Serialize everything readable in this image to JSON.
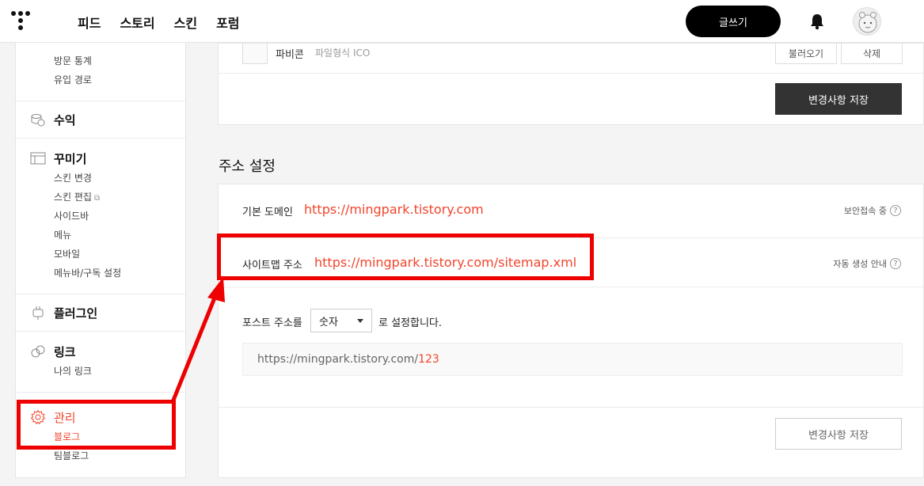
{
  "header": {
    "nav": [
      "피드",
      "스토리",
      "스킨",
      "포럼"
    ],
    "write_label": "글쓰기"
  },
  "sidebar": {
    "stats_subs": [
      "방문 통계",
      "유입 경로"
    ],
    "revenue": "수익",
    "decorate": {
      "title": "꾸미기",
      "items": [
        "스킨 변경",
        "스킨 편집",
        "사이드바",
        "메뉴",
        "모바일",
        "메뉴바/구독 설정"
      ]
    },
    "plugin": "플러그인",
    "link": {
      "title": "링크",
      "items": [
        "나의 링크"
      ]
    },
    "manage": {
      "title": "관리",
      "items": [
        "블로그",
        "팀블로그"
      ]
    }
  },
  "favicon": {
    "label": "파비콘",
    "note": "파일형식 ICO",
    "load_label": "불러오기",
    "delete_label": "삭제",
    "save_label": "변경사항 저장"
  },
  "address": {
    "title": "주소 설정",
    "domain_label": "기본 도메인",
    "domain_url": "https://mingpark.tistory.com",
    "domain_help": "보안접속 중",
    "sitemap_label": "사이트맵 주소",
    "sitemap_url": "https://mingpark.tistory.com/sitemap.xml",
    "sitemap_help": "자동 생성 안내",
    "post_label": "포스트 주소를",
    "post_select": "숫자",
    "post_suffix": "로 설정합니다.",
    "post_url_base": "https://mingpark.tistory.com/",
    "post_url_num": "123",
    "save_label": "변경사항 저장"
  },
  "colors": {
    "accent": "#f2442b",
    "annotation": "#ee0000",
    "dark_button": "#333333"
  }
}
